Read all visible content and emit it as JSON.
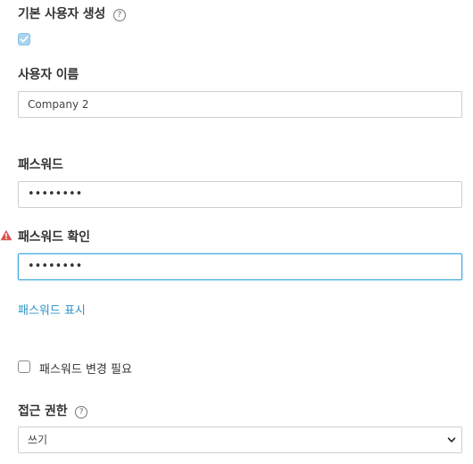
{
  "create_default_user": {
    "label": "기본 사용자 생성",
    "help_icon": "?",
    "checked": true
  },
  "username": {
    "label": "사용자 이름",
    "value": "Company 2"
  },
  "password": {
    "label": "패스워드",
    "masked_value": "••••••••"
  },
  "password_confirm": {
    "label": "패스워드 확인",
    "masked_value": "••••••••",
    "warning_icon": "warning-icon"
  },
  "show_password_link": "패스워드 표시",
  "require_password_change": {
    "label": "패스워드 변경 필요",
    "checked": false
  },
  "access_rights": {
    "label": "접근 권한",
    "help_icon": "?",
    "selected": "쓰기"
  },
  "colors": {
    "accent": "#2f93c6",
    "focus_border": "#3fa9d9",
    "warning": "#d9534f"
  }
}
